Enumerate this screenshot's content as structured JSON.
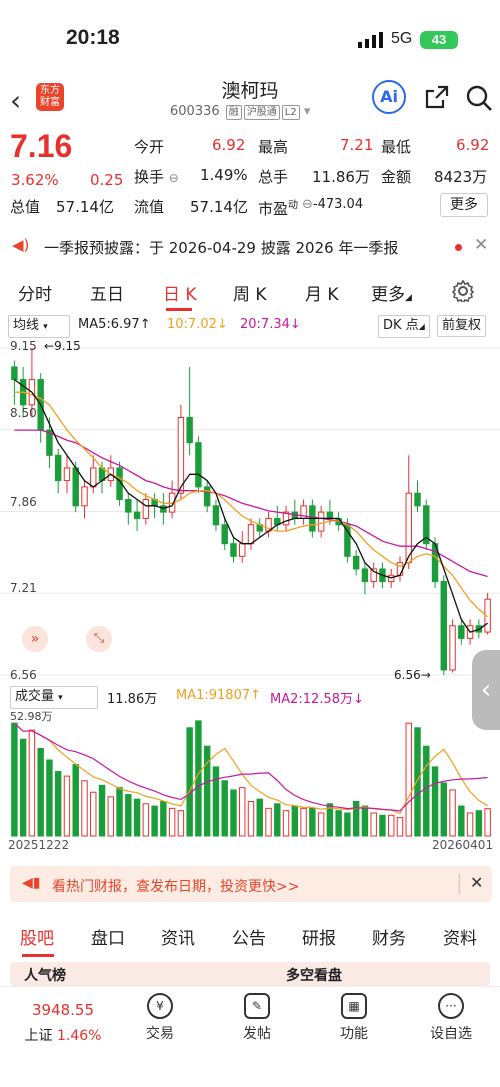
{
  "status": {
    "time": "20:18",
    "network": "5G",
    "battery": "43"
  },
  "header": {
    "app_logo": "东方\n财富",
    "title": "澳柯玛",
    "code": "600336",
    "tags": [
      "融",
      "沪股通",
      "L2"
    ],
    "ai_label": "Ai"
  },
  "quote": {
    "price": "7.16",
    "pct": "3.62%",
    "change": "0.25",
    "open_label": "今开",
    "open": "6.92",
    "high_label": "最高",
    "high": "7.21",
    "low_label": "最低",
    "low": "6.92",
    "turnover_label": "换手",
    "turnover": "1.49%",
    "volume_label": "总手",
    "volume": "11.86万",
    "amount_label": "金额",
    "amount": "8423万",
    "mcap_label": "总值",
    "mcap": "57.14亿",
    "float_label": "流值",
    "float": "57.14亿",
    "pe_label": "市盈",
    "pe_sup": "动",
    "pe": "-473.04",
    "more": "更多"
  },
  "notice": {
    "text": "一季报预披露：于 2026-04-29 披露 2026 年一季报"
  },
  "tabs": [
    "分时",
    "五日",
    "日 K",
    "周 K",
    "月 K",
    "更多"
  ],
  "ma": {
    "type": "均线",
    "ma5": "MA5:6.97",
    "ma10": "10:7.02",
    "ma20": "20:7.34",
    "dk": "DK 点",
    "adj": "前复权"
  },
  "price_axis": {
    "top": "9.15",
    "high_marker": "9.15",
    "l2": "8.50",
    "mid": "7.86",
    "l4": "7.21",
    "bottom": "6.56",
    "low_marker": "6.56"
  },
  "volume": {
    "label": "成交量",
    "value": "11.86万",
    "ma1": "MA1:91807",
    "ma2": "MA2:12.58万",
    "axis_top": "52.98万"
  },
  "dates": {
    "start": "20251222",
    "end": "20260401"
  },
  "banner": {
    "text": "看热门财报，查发布日期，投资更快>>"
  },
  "bottom_tabs": [
    "股吧",
    "盘口",
    "资讯",
    "公告",
    "研报",
    "财务",
    "资料"
  ],
  "strip": {
    "left": "人气榜",
    "right": "多空看盘"
  },
  "nav": {
    "index_value": "3948.55",
    "index_name": "上证",
    "index_pct": "1.46%",
    "items": [
      "交易",
      "发帖",
      "功能",
      "设自选"
    ]
  },
  "colors": {
    "up": "#e8312f",
    "down": "#1a9e3a",
    "ma5": "#111111",
    "ma10": "#f0a020",
    "ma20": "#c8189e"
  },
  "chart_data": {
    "type": "candlestick",
    "ylim": [
      6.56,
      9.15
    ],
    "candles": [
      [
        9.0,
        8.9,
        9.05,
        8.7
      ],
      [
        8.9,
        8.7,
        9.0,
        8.6
      ],
      [
        8.7,
        8.9,
        9.15,
        8.6
      ],
      [
        8.9,
        8.5,
        8.95,
        8.4
      ],
      [
        8.5,
        8.3,
        8.6,
        8.2
      ],
      [
        8.3,
        8.1,
        8.35,
        8.0
      ],
      [
        8.1,
        8.2,
        8.3,
        8.0
      ],
      [
        8.2,
        7.9,
        8.25,
        7.85
      ],
      [
        7.9,
        8.05,
        8.1,
        7.8
      ],
      [
        8.05,
        8.2,
        8.3,
        8.0
      ],
      [
        8.2,
        8.1,
        8.25,
        8.0
      ],
      [
        8.1,
        8.2,
        8.3,
        8.05
      ],
      [
        8.2,
        7.95,
        8.25,
        7.9
      ],
      [
        7.95,
        7.85,
        8.0,
        7.75
      ],
      [
        7.85,
        7.8,
        7.95,
        7.7
      ],
      [
        7.8,
        7.95,
        8.0,
        7.75
      ],
      [
        7.95,
        7.9,
        8.0,
        7.8
      ],
      [
        7.9,
        7.85,
        8.0,
        7.75
      ],
      [
        7.85,
        8.0,
        8.1,
        7.8
      ],
      [
        8.0,
        8.6,
        8.7,
        7.95
      ],
      [
        8.6,
        8.4,
        9.0,
        8.3
      ],
      [
        8.4,
        8.05,
        8.45,
        8.0
      ],
      [
        8.05,
        7.9,
        8.1,
        7.85
      ],
      [
        7.9,
        7.75,
        7.95,
        7.7
      ],
      [
        7.75,
        7.6,
        7.8,
        7.55
      ],
      [
        7.6,
        7.5,
        7.65,
        7.45
      ],
      [
        7.5,
        7.6,
        7.7,
        7.45
      ],
      [
        7.6,
        7.75,
        7.8,
        7.55
      ],
      [
        7.75,
        7.7,
        7.8,
        7.65
      ],
      [
        7.7,
        7.8,
        7.85,
        7.65
      ],
      [
        7.8,
        7.75,
        7.9,
        7.7
      ],
      [
        7.75,
        7.85,
        7.9,
        7.7
      ],
      [
        7.85,
        7.8,
        7.95,
        7.75
      ],
      [
        7.8,
        7.9,
        7.95,
        7.75
      ],
      [
        7.9,
        7.7,
        7.95,
        7.65
      ],
      [
        7.7,
        7.85,
        7.9,
        7.65
      ],
      [
        7.85,
        7.8,
        7.95,
        7.75
      ],
      [
        7.8,
        7.75,
        7.85,
        7.7
      ],
      [
        7.75,
        7.5,
        7.8,
        7.45
      ],
      [
        7.5,
        7.4,
        7.55,
        7.35
      ],
      [
        7.4,
        7.3,
        7.45,
        7.2
      ],
      [
        7.3,
        7.4,
        7.45,
        7.25
      ],
      [
        7.4,
        7.3,
        7.45,
        7.25
      ],
      [
        7.3,
        7.35,
        7.4,
        7.25
      ],
      [
        7.35,
        7.45,
        7.5,
        7.3
      ],
      [
        7.45,
        8.0,
        8.3,
        7.4
      ],
      [
        8.0,
        7.9,
        8.1,
        7.85
      ],
      [
        7.9,
        7.6,
        7.95,
        7.55
      ],
      [
        7.6,
        7.3,
        7.65,
        7.25
      ],
      [
        7.3,
        6.6,
        7.35,
        6.56
      ],
      [
        6.6,
        6.95,
        7.0,
        6.58
      ],
      [
        6.95,
        6.85,
        7.0,
        6.8
      ],
      [
        6.85,
        6.95,
        7.0,
        6.8
      ],
      [
        6.95,
        6.9,
        7.0,
        6.85
      ],
      [
        6.9,
        7.16,
        7.21,
        6.88
      ]
    ],
    "ma5": [
      8.9,
      8.85,
      8.8,
      8.7,
      8.55,
      8.4,
      8.3,
      8.2,
      8.1,
      8.05,
      8.1,
      8.15,
      8.1,
      8.0,
      7.95,
      7.9,
      7.9,
      7.88,
      7.9,
      8.05,
      8.15,
      8.15,
      8.1,
      8.0,
      7.8,
      7.65,
      7.6,
      7.6,
      7.65,
      7.7,
      7.75,
      7.78,
      7.8,
      7.8,
      7.8,
      7.8,
      7.8,
      7.8,
      7.7,
      7.6,
      7.45,
      7.38,
      7.35,
      7.33,
      7.35,
      7.5,
      7.6,
      7.65,
      7.6,
      7.4,
      7.2,
      7.0,
      6.9,
      6.92,
      6.97
    ],
    "ma10": [
      8.8,
      8.8,
      8.78,
      8.75,
      8.7,
      8.6,
      8.5,
      8.42,
      8.35,
      8.28,
      8.2,
      8.15,
      8.12,
      8.08,
      8.02,
      7.98,
      7.95,
      7.92,
      7.92,
      7.95,
      8.0,
      8.02,
      8.02,
      8.0,
      7.95,
      7.88,
      7.82,
      7.78,
      7.75,
      7.72,
      7.7,
      7.7,
      7.72,
      7.74,
      7.75,
      7.76,
      7.78,
      7.78,
      7.75,
      7.7,
      7.62,
      7.55,
      7.5,
      7.45,
      7.42,
      7.45,
      7.5,
      7.52,
      7.5,
      7.42,
      7.35,
      7.25,
      7.15,
      7.08,
      7.02
    ],
    "ma20": [
      8.5,
      8.5,
      8.5,
      8.5,
      8.48,
      8.45,
      8.42,
      8.4,
      8.36,
      8.32,
      8.28,
      8.25,
      8.22,
      8.18,
      8.14,
      8.1,
      8.08,
      8.05,
      8.03,
      8.02,
      8.02,
      8.02,
      8.01,
      8.0,
      7.98,
      7.95,
      7.92,
      7.9,
      7.88,
      7.86,
      7.85,
      7.84,
      7.83,
      7.82,
      7.81,
      7.8,
      7.79,
      7.78,
      7.76,
      7.74,
      7.7,
      7.66,
      7.62,
      7.6,
      7.58,
      7.58,
      7.58,
      7.56,
      7.54,
      7.5,
      7.46,
      7.42,
      7.38,
      7.36,
      7.34
    ],
    "volumes": [
      49,
      42,
      46,
      38,
      33,
      28,
      26,
      31,
      24,
      19,
      22,
      17,
      21,
      18,
      16,
      14,
      13,
      15,
      12,
      11,
      47,
      50,
      39,
      30,
      24,
      20,
      21,
      15,
      16,
      12,
      14,
      11,
      13,
      12,
      12,
      10,
      14,
      11,
      10,
      15,
      13,
      10,
      9,
      9,
      8,
      49,
      47,
      39,
      30,
      23,
      20,
      13,
      10,
      11,
      11.86
    ],
    "vol_ylim": [
      0,
      52.98
    ]
  }
}
